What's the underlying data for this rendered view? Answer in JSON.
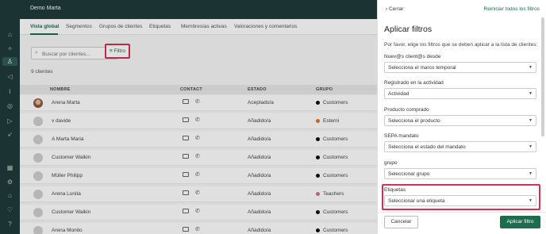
{
  "app": {
    "title": "Demo Marta"
  },
  "tabs": [
    {
      "label": "Vista global"
    },
    {
      "label": "Segmentos"
    },
    {
      "label": "Grupos de clientes"
    },
    {
      "label": "Etiquetas"
    },
    {
      "label": "Membresías activas"
    },
    {
      "label": "Valoraciones y comentarios"
    }
  ],
  "toolbar": {
    "search_placeholder": "Buscar por clientes...",
    "filter_label": "Filtro"
  },
  "client_count": "9 clientes",
  "table": {
    "headers": {
      "name": "NOMBRE",
      "contact": "CONTACT",
      "status": "ESTADO",
      "group": "GRUPO"
    },
    "rows": [
      {
        "name": "Arena Marta",
        "status": "Aceptado/a",
        "group": "Customers",
        "group_color": "#111111"
      },
      {
        "name": "v davide",
        "status": "Añadido/a",
        "group": "Esterni",
        "group_color": "#e0762b"
      },
      {
        "name": "A Marta Maria",
        "status": "Añadido/a",
        "group": "Customers",
        "group_color": "#111111"
      },
      {
        "name": "Customer Walkin",
        "status": "Añadido/a",
        "group": "Customers",
        "group_color": "#111111"
      },
      {
        "name": "Müller Philipp",
        "status": "Añadido/a",
        "group": "Customers",
        "group_color": "#111111"
      },
      {
        "name": "Arena Lunita",
        "status": "Añadido/a",
        "group": "Teachers",
        "group_color": "#c07a8a"
      },
      {
        "name": "Customer Walkin",
        "status": "Añadido/a",
        "group": "Customers",
        "group_color": "#111111"
      },
      {
        "name": "Arena Monito",
        "status": "Añadido/a",
        "group": "Customers",
        "group_color": "#111111"
      }
    ]
  },
  "panel": {
    "close_label": "Cerrar",
    "reset_label": "Reiniciar todos los filtros",
    "title": "Aplicar filtros",
    "description": "Por favor, elige los filtros que se deben aplicar a la lista de clientes:",
    "filters": [
      {
        "label": "Nuev@s client@s desde",
        "value": "Selecciona el marco temporal"
      },
      {
        "label": "Registrado en la actividad",
        "value": "Actividad"
      },
      {
        "label": "Producto comprado",
        "value": "Selecciona el producto"
      },
      {
        "label": "SEPA mandato",
        "value": "Selecciona el estado del mandato"
      },
      {
        "label": "grupo",
        "value": "Seleccionar grupo"
      },
      {
        "label": "Etiquetas",
        "value": "Seleccionar una etiqueta"
      }
    ],
    "cancel_label": "Cancelar",
    "apply_label": "Aplicar filtro"
  },
  "colors": {
    "accent": "#1f6b4e",
    "highlight": "#d43054",
    "rail": "#1f3b3a"
  }
}
